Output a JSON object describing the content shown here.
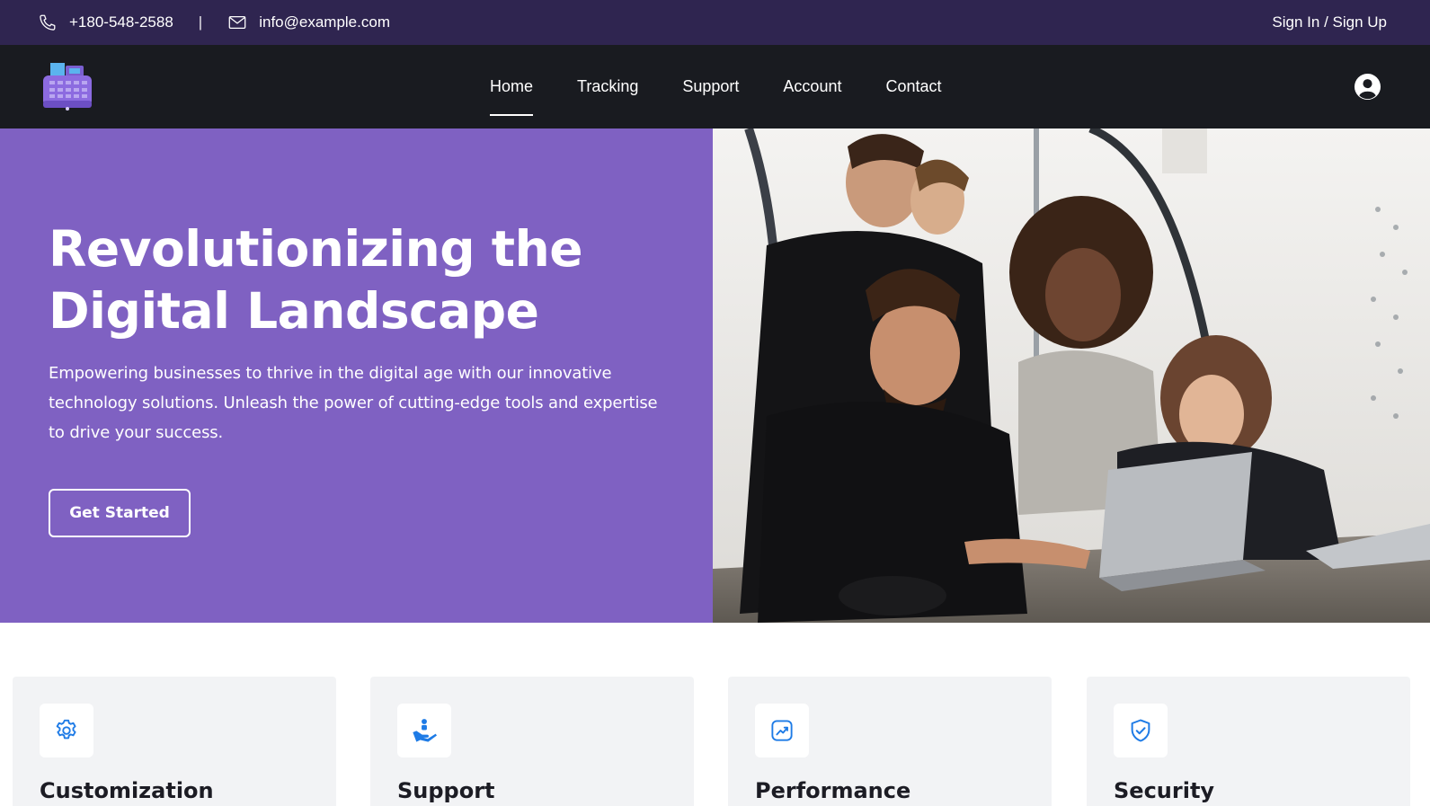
{
  "topbar": {
    "phone": "+180-548-2588",
    "separator": "|",
    "email": "info@example.com",
    "signin": "Sign In / Sign Up",
    "phone_icon": "phone-icon",
    "mail_icon": "mail-icon"
  },
  "nav": {
    "logo_icon": "cash-register-icon",
    "items": [
      {
        "label": "Home",
        "active": true
      },
      {
        "label": "Tracking",
        "active": false
      },
      {
        "label": "Support",
        "active": false
      },
      {
        "label": "Account",
        "active": false
      },
      {
        "label": "Contact",
        "active": false
      }
    ],
    "user_icon": "user-circle-icon"
  },
  "hero": {
    "title_line1": "Revolutionizing the",
    "title_line2": "Digital Landscape",
    "subtitle": "Empowering businesses to thrive in the digital age with our innovative technology solutions. Unleash the power of cutting-edge tools and expertise to drive your success.",
    "cta": "Get Started",
    "bg_color": "#7f61c2"
  },
  "features": [
    {
      "title": "Customization",
      "icon": "gear-icon"
    },
    {
      "title": "Support",
      "icon": "helping-hand-icon"
    },
    {
      "title": "Performance",
      "icon": "trending-up-icon"
    },
    {
      "title": "Security",
      "icon": "shield-check-icon"
    }
  ],
  "colors": {
    "topbar": "#2f2550",
    "navbar": "#191b20",
    "hero": "#7f61c2",
    "accent_blue": "#1e7be6",
    "card_bg": "#f2f3f5"
  }
}
